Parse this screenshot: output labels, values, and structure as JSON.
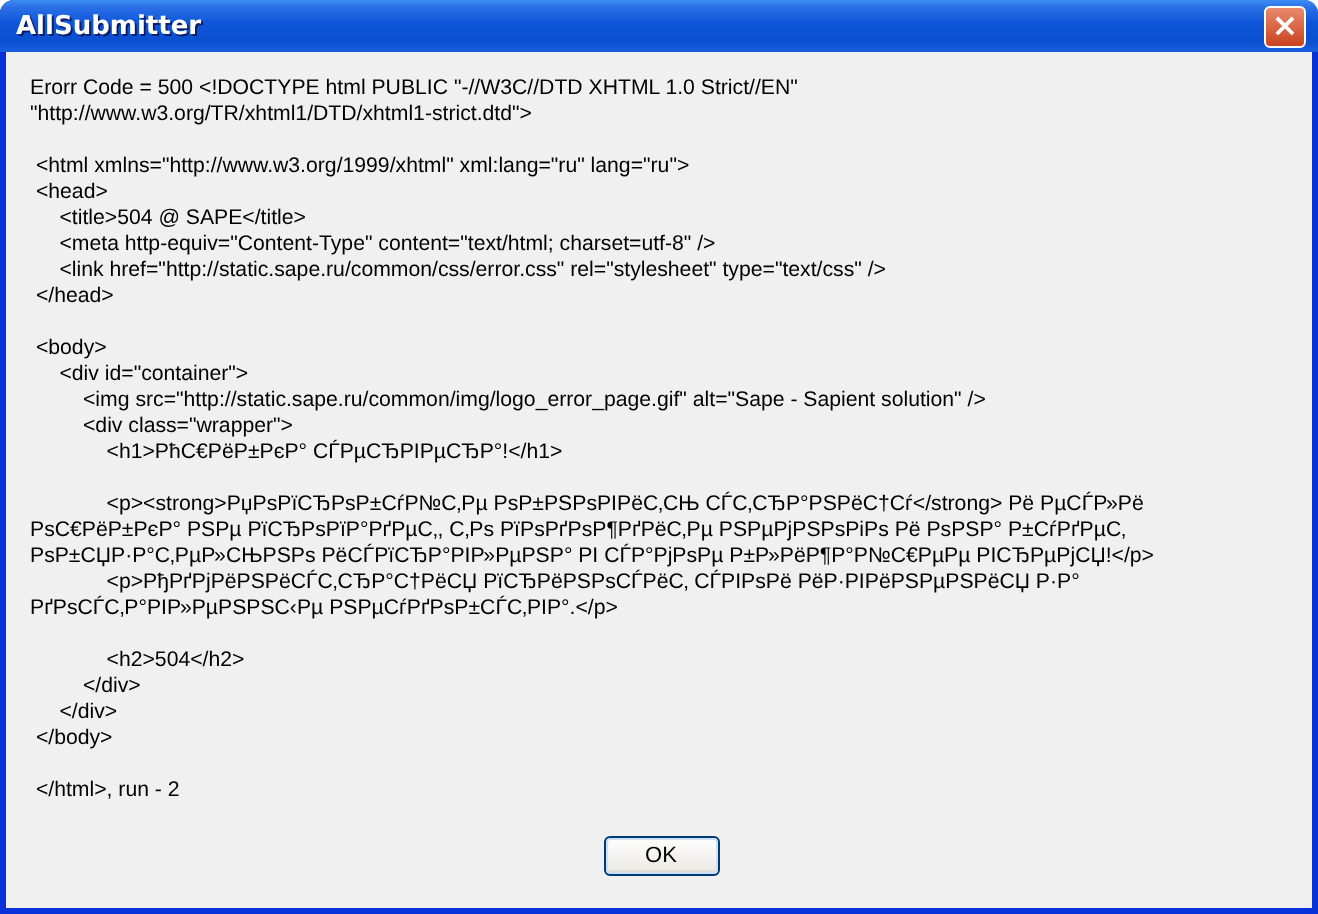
{
  "window": {
    "title": "AllSubmitter",
    "close": "×"
  },
  "message": "Erorr Code = 500 <!DOCTYPE html PUBLIC \"-//W3C//DTD XHTML 1.0 Strict//EN\"\n\"http://www.w3.org/TR/xhtml1/DTD/xhtml1-strict.dtd\">\n\n <html xmlns=\"http://www.w3.org/1999/xhtml\" xml:lang=\"ru\" lang=\"ru\">\n <head>\n     <title>504 @ SAPE</title>\n     <meta http-equiv=\"Content-Type\" content=\"text/html; charset=utf-8\" />\n     <link href=\"http://static.sape.ru/common/css/error.css\" rel=\"stylesheet\" type=\"text/css\" />\n </head>\n\n <body>\n     <div id=\"container\">\n         <img src=\"http://static.sape.ru/common/img/logo_error_page.gif\" alt=\"Sape - Sapient solution\" />\n         <div class=\"wrapper\">\n             <h1>РћС€РёР±РєР° СЃРµСЂРІРµСЂР°!</h1>\n\n             <p><strong>РџРѕРїСЂРѕР±СѓР№С‚Рµ РѕР±РЅРѕРІРёС‚СЊ СЃС‚СЂР°РЅРёС†Сѓ</strong> Рё РµСЃР»Рё РѕС€РёР±РєР° РЅРµ РїСЂРѕРїР°РґРµС‚, С‚Рѕ РїРѕРґРѕР¶РґРёС‚Рµ РЅРµРјРЅРѕРіРѕ Рё РѕРЅР° Р±СѓРґРµС‚ РѕР±СЏР·Р°С‚РµР»СЊРЅРѕ РёСЃРїСЂР°РІР»РµРЅР° РІ СЃР°РјРѕРµ Р±Р»РёР¶Р°Р№С€РµРµ РІСЂРµРјСЏ!</p>\n             <p>РђРґРјРёРЅРёСЃС‚СЂР°С†РёСЏ РїСЂРёРЅРѕСЃРёС‚ СЃРІРѕРё РёР·РІРёРЅРµРЅРёСЏ Р·Р° РґРѕСЃС‚Р°РІР»РµРЅРЅС‹Рµ РЅРµСѓРґРѕР±СЃС‚РІР°.</p>\n\n             <h2>504</h2>\n         </div>\n     </div>\n </body>\n\n </html>, run - 2",
  "buttons": [
    "OK"
  ]
}
